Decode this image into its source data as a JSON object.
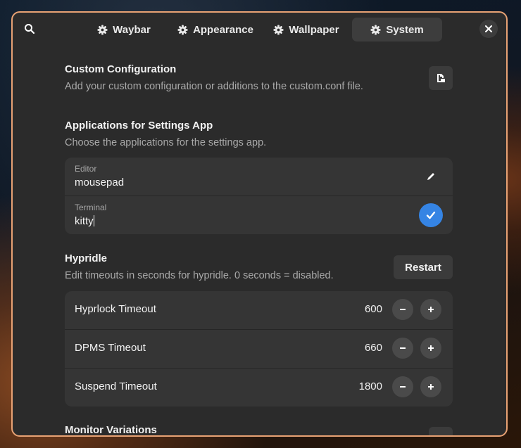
{
  "tabs": [
    {
      "label": "Waybar",
      "icon": "gear-icon"
    },
    {
      "label": "Appearance",
      "icon": "gear-icon"
    },
    {
      "label": "Wallpaper",
      "icon": "gear-icon"
    },
    {
      "label": "System",
      "icon": "gear-icon",
      "active": true
    }
  ],
  "custom_config": {
    "title": "Custom Configuration",
    "subtitle": "Add your custom configuration or additions to the custom.conf file."
  },
  "apps": {
    "title": "Applications for Settings App",
    "subtitle": "Choose the applications for the settings app.",
    "editor": {
      "label": "Editor",
      "value": "mousepad"
    },
    "terminal": {
      "label": "Terminal",
      "value": "kitty"
    }
  },
  "hypridle": {
    "title": "Hypridle",
    "subtitle": "Edit timeouts in seconds for hypridle. 0 seconds = disabled.",
    "restart_label": "Restart",
    "rows": [
      {
        "label": "Hyprlock Timeout",
        "value": "600"
      },
      {
        "label": "DPMS Timeout",
        "value": "660"
      },
      {
        "label": "Suspend Timeout",
        "value": "1800"
      }
    ]
  },
  "monitor": {
    "title": "Monitor Variations"
  },
  "colors": {
    "accent": "#3584e4",
    "window_border": "#e8a274",
    "window_bg": "#2b2b2b"
  }
}
